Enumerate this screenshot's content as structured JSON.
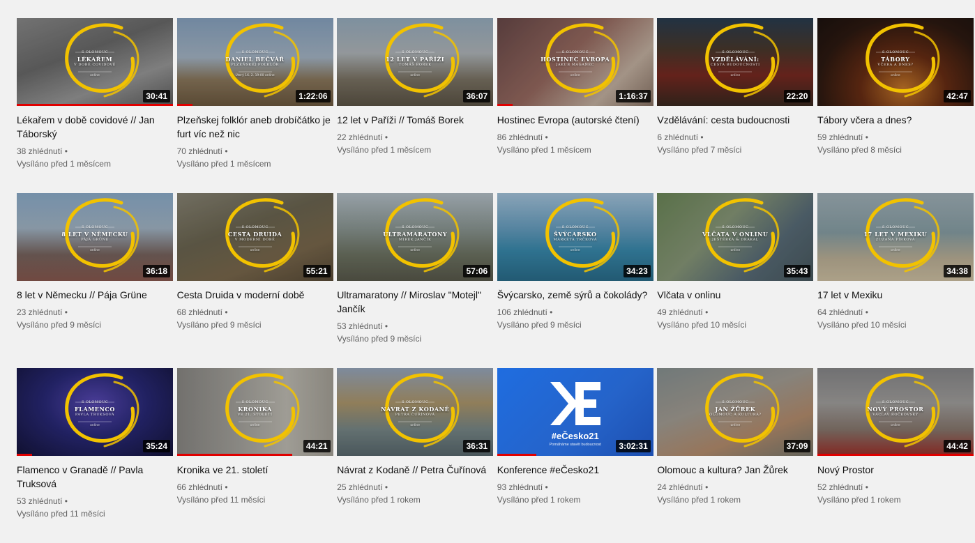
{
  "accent": "#e00000",
  "ring_color": "#f2c200",
  "videos": [
    {
      "title": "Lékařem v době covidové // Jan Táborský",
      "views": "38 zhlédnutí •",
      "age": "Vysíláno před 1 měsícem",
      "duration": "30:41",
      "progress": 1.0,
      "thumb": {
        "l1": "S OLOMOUC",
        "l2": "LÉKAŘEM",
        "l3": "V DOBĚ COVIDOVÉ",
        "l4": "online"
      },
      "bg": "linear-gradient(160deg,#8c8c8c 0%,#6b6b6b 40%,#9a9a9a 70%,#5e5e5e 100%)"
    },
    {
      "title": "Plzeňskej folklór aneb drobíčátko je furt víc než nic",
      "views": "70 zhlédnutí •",
      "age": "Vysíláno před 1 měsícem",
      "duration": "1:22:06",
      "progress": 0.1,
      "thumb": {
        "l1": "S OLOMOUC",
        "l2": "DANIEL BEČVÁŘ",
        "l3": "PLZEŇSKEJ FOLKLÓR",
        "l4": "Úterý 16. 2. 19:00 online"
      },
      "bg": "linear-gradient(180deg,#8aa6c4 0%,#a8b8c8 45%,#8d7a5e 70%,#6e5a40 100%)"
    },
    {
      "title": "12 let v Paříži // Tomáš Borek",
      "views": "22 zhlédnutí •",
      "age": "Vysíláno před 1 měsícem",
      "duration": "36:07",
      "progress": 0.0,
      "thumb": {
        "l1": "S OLOMOUC",
        "l2": "12 LET V PAŘÍŽI",
        "l3": "TOMÁŠ BOREK",
        "l4": "online"
      },
      "bg": "linear-gradient(180deg,#9ab0c2 0%,#b3b9bd 40%,#7d7565 70%,#5d5547 100%)"
    },
    {
      "title": "Hostinec Evropa (autorské čtení)",
      "views": "86 zhlédnutí •",
      "age": "Vysíláno před 1 měsícem",
      "duration": "1:16:37",
      "progress": 0.1,
      "thumb": {
        "l1": "S OLOMOUC",
        "l2": "HOSTINEC EVROPA",
        "l3": "JAKUB MAGANEC",
        "l4": "online"
      },
      "bg": "linear-gradient(135deg,#6a4a4a 0%,#9a6c62 45%,#c7b4a4 75%,#8a7466 100%)"
    },
    {
      "title": "Vzdělávání: cesta budoucnosti",
      "views": "6 zhlédnutí •",
      "age": "Vysíláno před 7 měsíci",
      "duration": "22:20",
      "progress": 0.0,
      "thumb": {
        "l1": "S OLOMOUC",
        "l2": "VZDĚLÁVÁNÍ:",
        "l3": "CESTA BUDOUCNOSTI",
        "l4": "online"
      },
      "bg": "linear-gradient(180deg,#2a3d52 0%,#4a3a2e 35%,#7a2a22 65%,#3a2a20 100%)"
    },
    {
      "title": "Tábory včera a dnes?",
      "views": "59 zhlédnutí •",
      "age": "Vysíláno před 8 měsíci",
      "duration": "42:47",
      "progress": 0.0,
      "thumb": {
        "l1": "S OLOMOUC",
        "l2": "TÁBORY",
        "l3": "VČERA A DNES?",
        "l4": "online"
      },
      "bg": "radial-gradient(ellipse at 55% 80%,#c8782a 0%,#6a2e14 35%,#2e1a12 70%,#1c120e 100%)"
    },
    {
      "title": "8 let v Německu // Pája Grüne",
      "views": "23 zhlédnutí •",
      "age": "Vysíláno před 9 měsíci",
      "duration": "36:18",
      "progress": 0.0,
      "thumb": {
        "l1": "S OLOMOUC",
        "l2": "8 LET V NĚMECKU",
        "l3": "PÁJA GRÜNE",
        "l4": "online"
      },
      "bg": "linear-gradient(180deg,#8fb0cf 0%,#a5b8c9 40%,#7a6660 70%,#8a5a50 100%)"
    },
    {
      "title": "Cesta Druida v moderní době",
      "views": "68 zhlédnutí •",
      "age": "Vysíláno před 9 měsíci",
      "duration": "55:21",
      "progress": 0.0,
      "thumb": {
        "l1": "S OLOMOUC",
        "l2": "CESTA DRUIDA",
        "l3": "V MODERNÍ DOBĚ",
        "l4": "online"
      },
      "bg": "linear-gradient(160deg,#8a8676 0%,#6d6752 40%,#7c6a4e 70%,#5a4c38 100%)"
    },
    {
      "title": "Ultramaratony // Miroslav \"Motejl\" Jančík",
      "views": "53 zhlédnutí •",
      "age": "Vysíláno před 9 měsíci",
      "duration": "57:06",
      "progress": 0.0,
      "thumb": {
        "l1": "S OLOMOUC",
        "l2": "ULTRAMARATONY",
        "l3": "MIREK JANČÍK",
        "l4": "online"
      },
      "bg": "linear-gradient(180deg,#b8c4cc 0%,#8e9a96 40%,#6f7564 70%,#5a5a4c 100%)"
    },
    {
      "title": "Švýcarsko, země sýrů a čokolády?",
      "views": "106 zhlédnutí •",
      "age": "Vysíláno před 9 měsíci",
      "duration": "34:23",
      "progress": 0.0,
      "thumb": {
        "l1": "S OLOMOUC",
        "l2": "ŠVÝCARSKO",
        "l3": "MARKÉTA TRČKOVÁ",
        "l4": "online"
      },
      "bg": "linear-gradient(180deg,#a8c8e0 0%,#6aa2c4 40%,#3a8cb0 65%,#2a6e8c 100%)"
    },
    {
      "title": "Vlčata v onlinu",
      "views": "49 zhlédnutí •",
      "age": "Vysíláno před 10 měsíci",
      "duration": "35:43",
      "progress": 0.0,
      "thumb": {
        "l1": "S OLOMOUC",
        "l2": "VLČATA V ONLINU",
        "l3": "JEŠTĚRKA & DRAKAL",
        "l4": "online"
      },
      "bg": "linear-gradient(135deg,#6e8a5a 0%,#8a9a7a 40%,#5a6e7a 70%,#4a5a60 100%)"
    },
    {
      "title": "17 let v Mexiku",
      "views": "64 zhlédnutí •",
      "age": "Vysíláno před 10 měsíci",
      "duration": "34:38",
      "progress": 0.0,
      "thumb": {
        "l1": "S OLOMOUC",
        "l2": "17 LET V MEXIKU",
        "l3": "ZUZANA PÍRKOVÁ",
        "l4": "online"
      },
      "bg": "linear-gradient(180deg,#a4b4bc 0%,#8aa2a8 45%,#c0b49a 75%,#d2c4a6 100%)"
    },
    {
      "title": "Flamenco v Granadě // Pavla Truksová",
      "views": "53 zhlédnutí •",
      "age": "Vysíláno před 11 měsíci",
      "duration": "35:24",
      "progress": 0.1,
      "thumb": {
        "l1": "S OLOMOUC",
        "l2": "FLAMENCO",
        "l3": "PAVLA TRUKSOVÁ",
        "l4": "online"
      },
      "bg": "radial-gradient(ellipse at 50% 40%,#5a4ab8 0%,#2a2a7a 45%,#14143a 100%)"
    },
    {
      "title": "Kronika ve 21. století",
      "views": "66 zhlédnutí •",
      "age": "Vysíláno před 11 měsíci",
      "duration": "44:21",
      "progress": 0.74,
      "thumb": {
        "l1": "S OLOMOUC",
        "l2": "KRONIKA",
        "l3": "VE 21. STOLETÍ",
        "l4": "online"
      },
      "bg": "linear-gradient(90deg,#8c8a86 0%,#a8a6a0 40%,#c2bfb6 70%,#a8a49a 100%)"
    },
    {
      "title": "Návrat z Kodaně // Petra Čuřínová",
      "views": "25 zhlédnutí •",
      "age": "Vysíláno před 1 rokem",
      "duration": "36:31",
      "progress": 0.0,
      "thumb": {
        "l1": "S OLOMOUC",
        "l2": "NÁVRAT Z KODANĚ",
        "l3": "PETRA ČUŘÍNOVÁ",
        "l4": "online"
      },
      "bg": "linear-gradient(180deg,#9aaac0 0%,#b09a6e 40%,#7a8a8a 70%,#5a6a70 100%)"
    },
    {
      "title": "Konference #eČesko21",
      "views": "93 zhlédnutí •",
      "age": "Vysíláno před 1 rokem",
      "duration": "3:02:31",
      "progress": 0.25,
      "ecesko": {
        "tag": "#eČesko21",
        "sub": "Pomáháme stavět budoucnost"
      }
    },
    {
      "title": "Olomouc a kultura? Jan Žůrek",
      "views": "24 zhlédnutí •",
      "age": "Vysíláno před 1 rokem",
      "duration": "37:09",
      "progress": 0.0,
      "thumb": {
        "l1": "S OLOMOUC",
        "l2": "JAN ŽŮREK",
        "l3": "OLOMOUC A KULTURA?",
        "l4": "online"
      },
      "bg": "linear-gradient(160deg,#8a9494 0%,#a6a096 40%,#b89070 70%,#7a7a70 100%)"
    },
    {
      "title": "Nový Prostor",
      "views": "52 zhlédnutí •",
      "age": "Vysíláno před 1 rokem",
      "duration": "44:42",
      "progress": 1.0,
      "thumb": {
        "l1": "S OLOMOUC",
        "l2": "NOVÝ PROSTOR",
        "l3": "VÁCLAV ROČKOVSKÝ",
        "l4": "online"
      },
      "bg": "linear-gradient(180deg,#8a8a8c 0%,#a4a2a0 40%,#8a7a70 70%,#a0302a 100%)"
    }
  ]
}
